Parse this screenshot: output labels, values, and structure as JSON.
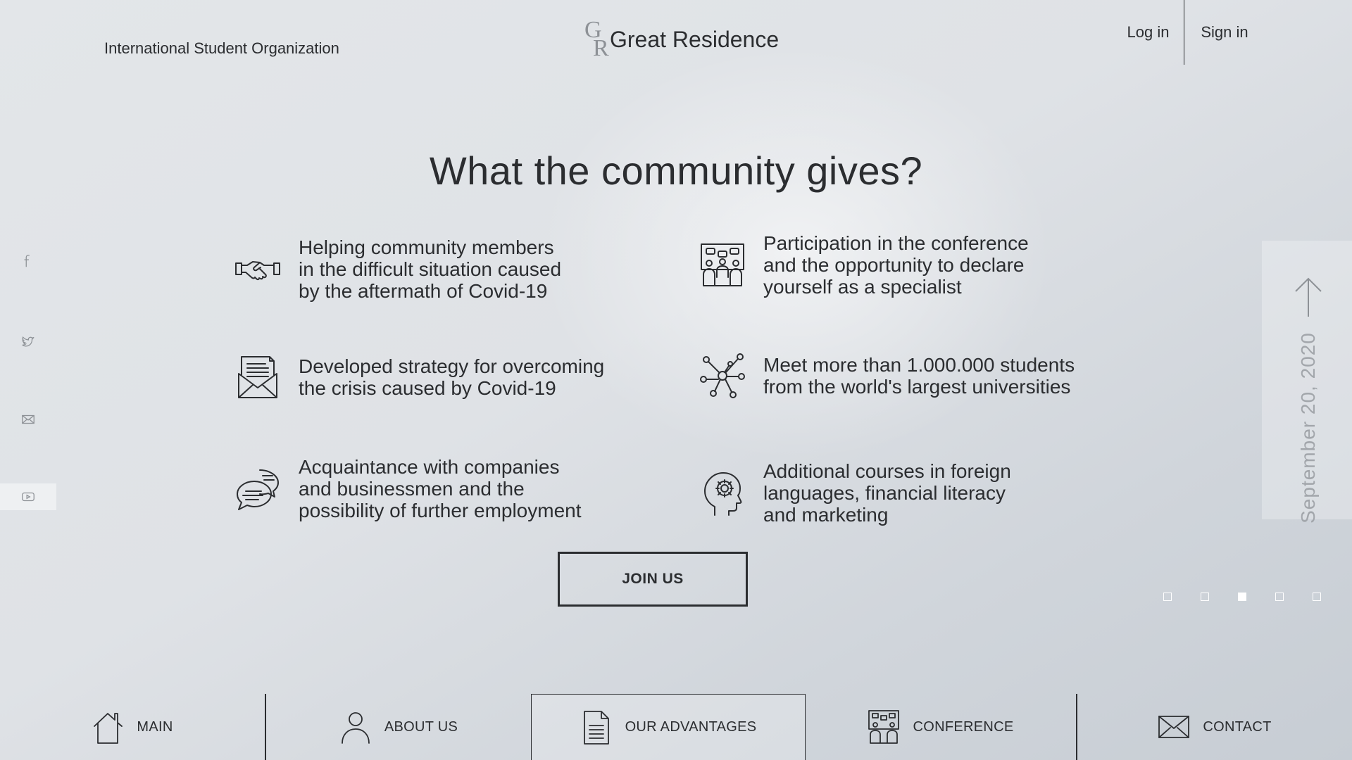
{
  "header": {
    "org_name": "International Student Organization",
    "logo_letter_top": "G",
    "logo_letter_bottom": "R",
    "site_name": "Great Residence",
    "login_label": "Log in",
    "signin_label": "Sign in"
  },
  "social": [
    {
      "icon": "facebook-icon"
    },
    {
      "icon": "twitter-icon"
    },
    {
      "icon": "mail-icon"
    },
    {
      "icon": "youtube-icon"
    }
  ],
  "main": {
    "heading": "What the community gives?",
    "features": [
      {
        "icon": "handshake-icon",
        "text": "Helping community members\nin the difficult situation caused\nby the aftermath of Covid-19"
      },
      {
        "icon": "conference-people-icon",
        "text": "Participation in the conference\nand the opportunity to declare\nyourself as a specialist"
      },
      {
        "icon": "letter-envelope-icon",
        "text": "Developed strategy for overcoming\nthe crisis caused by Covid-19"
      },
      {
        "icon": "network-icon",
        "text": "Meet more than 1.000.000 students\nfrom the world's largest universities"
      },
      {
        "icon": "chat-bubbles-icon",
        "text": "Acquaintance with companies\nand businessmen and the\npossibility of further employment"
      },
      {
        "icon": "head-gear-icon",
        "text": "Additional courses in foreign\nlanguages, financial literacy\nand marketing"
      }
    ],
    "join_label": "JOIN US"
  },
  "side_panel": {
    "date": "September 20, 2020",
    "active_page": 3,
    "page_count": 5
  },
  "nav": {
    "items": [
      {
        "label": "MAIN",
        "icon": "home-icon"
      },
      {
        "label": "ABOUT US",
        "icon": "person-icon"
      },
      {
        "label": "OUR ADVANTAGES",
        "icon": "document-icon",
        "selected": true
      },
      {
        "label": "CONFERENCE",
        "icon": "conference-icon"
      },
      {
        "label": "CONTACT",
        "icon": "envelope-icon"
      }
    ]
  },
  "colors": {
    "text": "#2b2d30",
    "muted": "#8d9196",
    "background": "#dfe2e6"
  }
}
